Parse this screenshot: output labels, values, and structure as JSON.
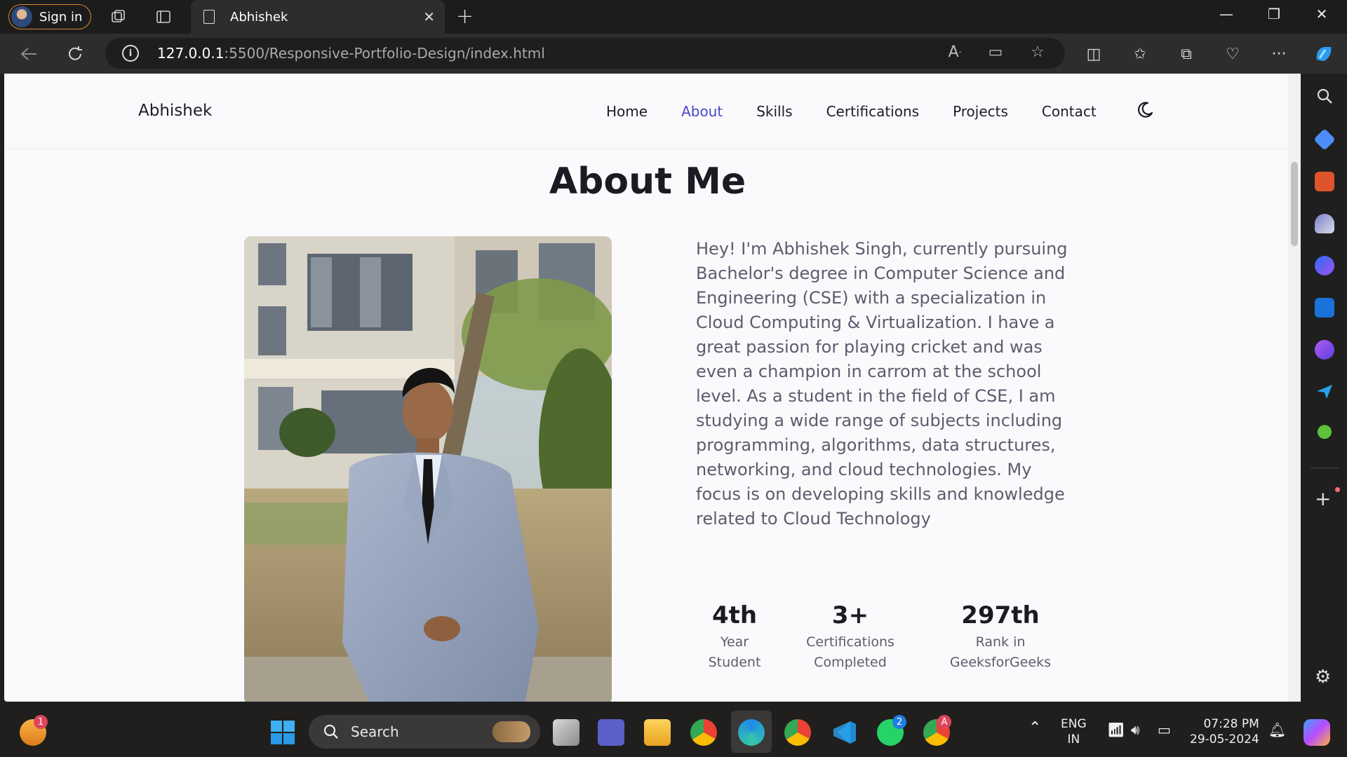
{
  "browser": {
    "signin_label": "Sign in",
    "tab_title": "Abhishek",
    "url_host": "127.0.0.1",
    "url_rest": ":5500/Responsive-Portfolio-Design/index.html"
  },
  "page": {
    "logo": "Abhishek",
    "nav": [
      "Home",
      "About",
      "Skills",
      "Certifications",
      "Projects",
      "Contact"
    ],
    "active_nav": "About",
    "title": "About Me",
    "bio": "Hey! I'm Abhishek Singh, currently pursuing Bachelor's degree in Computer Science and Engineering (CSE) with a specialization in Cloud Computing & Virtualization. I have a great passion for playing cricket and was even a champion in carrom at the school level. As a student in the field of CSE, I am studying a wide range of subjects including programming, algorithms, data structures, networking, and cloud technologies. My focus is on developing skills and knowledge related to Cloud Technology",
    "stats": [
      {
        "value": "4th",
        "label1": "Year",
        "label2": "Student"
      },
      {
        "value": "3+",
        "label1": "Certifications",
        "label2": "Completed"
      },
      {
        "value": "297th",
        "label1": "Rank in",
        "label2": "GeeksforGeeks"
      }
    ]
  },
  "taskbar": {
    "search_label": "Search",
    "lang1": "ENG",
    "lang2": "IN",
    "time": "07:28 PM",
    "date": "29-05-2024",
    "widgets_badge": "1",
    "whatsapp_badge": "2",
    "chrome_badge": "A"
  },
  "colors": {
    "accent": "#4a46c9",
    "heading": "#1b1b24",
    "text": "#5c5c6e",
    "page_bg": "#fafafc"
  }
}
